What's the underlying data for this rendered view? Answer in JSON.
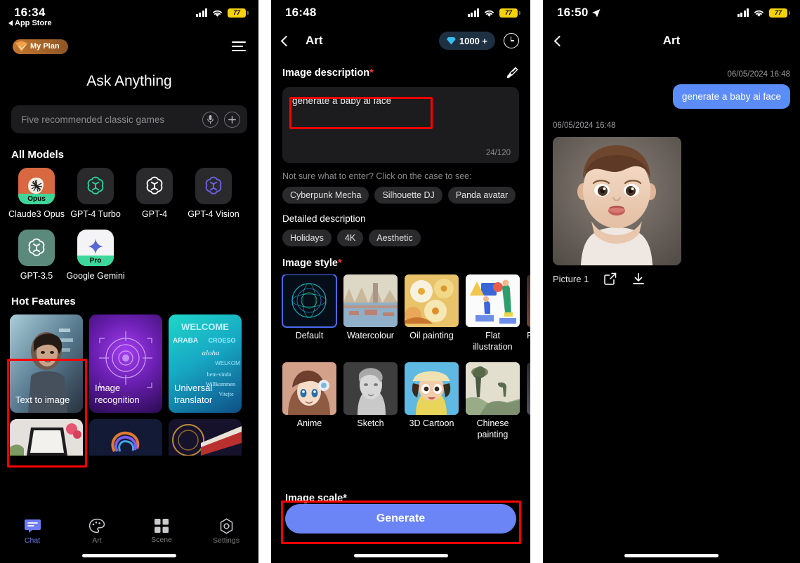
{
  "phone1": {
    "status": {
      "time": "16:34",
      "battery": "77",
      "back_app": "App Store"
    },
    "plan_badge": "My Plan",
    "title": "Ask Anything",
    "search": {
      "placeholder": "Five recommended classic games",
      "mic_icon": "microphone-icon",
      "add_icon": "plus-icon"
    },
    "models_header": "All Models",
    "models": [
      {
        "label": "Claude3 Opus",
        "badge": "Opus",
        "icon": "claude-icon"
      },
      {
        "label": "GPT-4 Turbo",
        "badge": "",
        "icon": "openai-icon"
      },
      {
        "label": "GPT-4",
        "badge": "",
        "icon": "openai-icon"
      },
      {
        "label": "GPT-4 Vision",
        "badge": "",
        "icon": "openai-icon"
      },
      {
        "label": "GPT-3.5",
        "badge": "",
        "icon": "openai-icon"
      },
      {
        "label": "Google Gemini",
        "badge": "Pro",
        "icon": "gemini-icon"
      }
    ],
    "features_header": "Hot Features",
    "features": [
      {
        "label": "Text to image"
      },
      {
        "label": "Image recognition"
      },
      {
        "label": "Universal translator"
      }
    ],
    "tabs": [
      {
        "label": "Chat",
        "icon": "chat-bubble-icon",
        "active": true
      },
      {
        "label": "Art",
        "icon": "palette-icon",
        "active": false
      },
      {
        "label": "Scene",
        "icon": "grid-icon",
        "active": false
      },
      {
        "label": "Settings",
        "icon": "gear-icon",
        "active": false
      }
    ]
  },
  "phone2": {
    "status": {
      "time": "16:48",
      "battery": "77"
    },
    "nav": {
      "title": "Art",
      "coins": "1000 +",
      "history_icon": "clock-icon",
      "back_icon": "chevron-left-icon"
    },
    "image_description": {
      "label": "Image description",
      "required": "*",
      "clear_icon": "brush-icon",
      "value": "generate a baby ai face",
      "counter": "24/120"
    },
    "hint": "Not sure what to enter? Click on the case to see:",
    "case_chips": [
      "Cyberpunk Mecha",
      "Silhouette DJ",
      "Panda avatar"
    ],
    "detailed_label": "Detailed description",
    "detail_chips": [
      "Holidays",
      "4K",
      "Aesthetic"
    ],
    "style_label": "Image style",
    "style_required": "*",
    "styles_row1": [
      "Default",
      "Watercolour",
      "Oil painting",
      "Flat illustration",
      "P"
    ],
    "styles_row2": [
      "Anime",
      "Sketch",
      "3D Cartoon",
      "Chinese painting"
    ],
    "selected_style": "Default",
    "scale_label": "Image scale*",
    "generate_label": "Generate"
  },
  "phone3": {
    "status": {
      "time": "16:50",
      "battery": "77",
      "location_icon": "location-arrow-icon"
    },
    "nav": {
      "title": "Art",
      "back_icon": "chevron-left-icon"
    },
    "sent_timestamp": "06/05/2024 16:48",
    "sent_message": "generate a baby ai face",
    "reply_timestamp": "06/05/2024 16:48",
    "picture_label": "Picture 1",
    "share_icon": "share-icon",
    "download_icon": "download-icon"
  },
  "colors": {
    "accent_blue": "#6b85f7",
    "bubble_blue": "#5b8cf7",
    "highlight_red": "#ff0000",
    "badge_green": "#3ed79a",
    "battery_yellow": "#f5d20c"
  }
}
